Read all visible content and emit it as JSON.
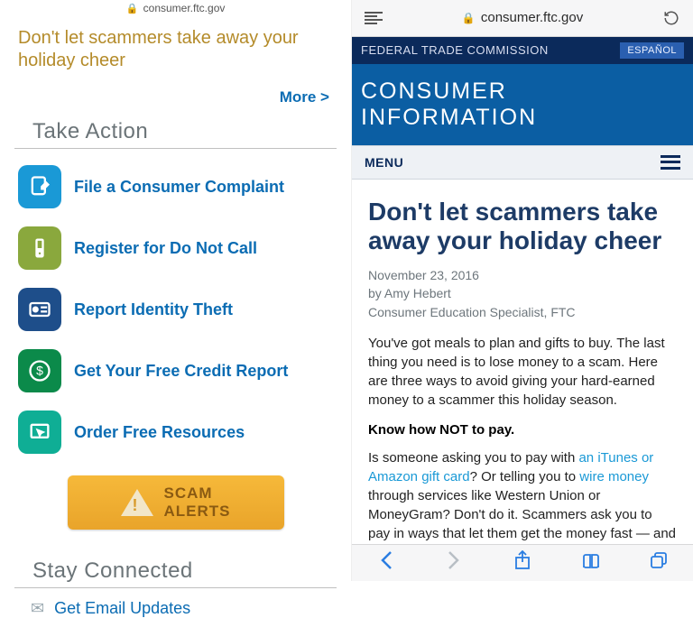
{
  "left": {
    "url": "consumer.ftc.gov",
    "article_link": "Don't let scammers take away your holiday cheer",
    "more": "More >",
    "take_action_title": "Take Action",
    "actions": [
      "File a Consumer Complaint",
      "Register for Do Not Call",
      "Report Identity Theft",
      "Get Your Free Credit Report",
      "Order Free Resources"
    ],
    "scam_line1": "SCAM",
    "scam_line2": "ALERTS",
    "stay_connected_title": "Stay Connected",
    "email_updates": "Get Email Updates"
  },
  "right": {
    "url": "consumer.ftc.gov",
    "org": "FEDERAL TRADE COMMISSION",
    "espanol": "ESPAÑOL",
    "banner": "CONSUMER INFORMATION",
    "menu": "MENU",
    "article": {
      "title": "Don't let scammers take away your holiday cheer",
      "date": "November 23, 2016",
      "byline": "by Amy Hebert",
      "role": "Consumer Education Specialist, FTC",
      "p1": "You've got meals to plan and gifts to buy. The last thing you need is to lose money to a scam. Here are three ways to avoid giving your hard-earned money to a scammer this holiday season.",
      "h2": "Know how NOT to pay.",
      "p2a": "Is someone asking you to pay with ",
      "p2link1": "an iTunes or Amazon gift card",
      "p2b": "? Or telling you to ",
      "p2link2": "wire money",
      "p2c": " through services like Western Union or MoneyGram? Don't do it. Scammers ask you to pay in ways that let them get the money fast — and make it nearly"
    }
  }
}
